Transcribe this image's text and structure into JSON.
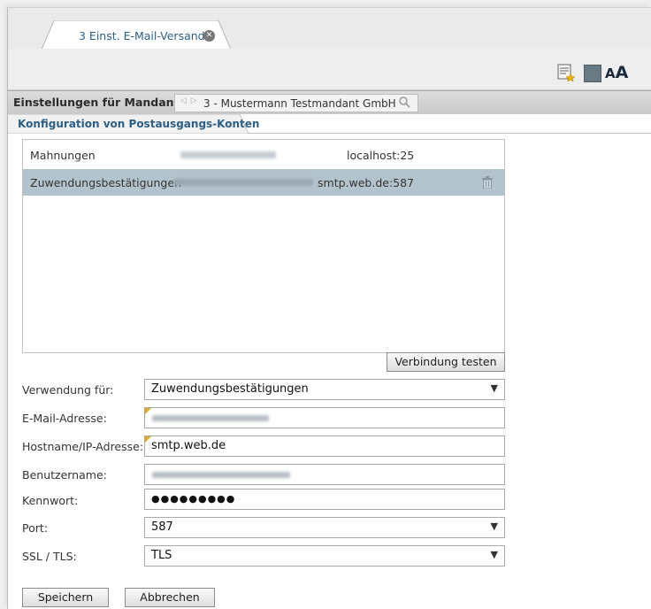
{
  "tab": {
    "label": "3 Einst. E-Mail-Versand"
  },
  "mandant": {
    "label": "Einstellungen für Mandant:",
    "value": "3 - Mustermann Testmandant GmbH"
  },
  "section": {
    "title": "Konfiguration von Postausgangs-Konten"
  },
  "accounts": [
    {
      "name": "Mahnungen",
      "server": "localhost:25"
    },
    {
      "name": "Zuwendungsbestätigungen",
      "server": "smtp.web.de:587"
    }
  ],
  "buttons": {
    "test": "Verbindung testen",
    "save": "Speichern",
    "cancel": "Abbrechen"
  },
  "form": {
    "verwendung_label": "Verwendung für:",
    "verwendung_value": "Zuwendungsbestätigungen",
    "email_label": "E-Mail-Adresse:",
    "host_label": "Hostname/IP-Adresse:",
    "host_value": "smtp.web.de",
    "user_label": "Benutzername:",
    "password_label": "Kennwort:",
    "password_value": "●●●●●●●●●",
    "port_label": "Port:",
    "port_value": "587",
    "ssl_label": "SSL / TLS:",
    "ssl_value": "TLS"
  },
  "colors": {
    "accent": "#2d5f86",
    "selected_row": "#b3c3cd",
    "changed_marker": "#e0a92a"
  },
  "icons": [
    "close-icon",
    "notes-star-icon",
    "square-icon",
    "font-size-icon",
    "trash-icon",
    "chevron-down-icon",
    "search-icon"
  ]
}
